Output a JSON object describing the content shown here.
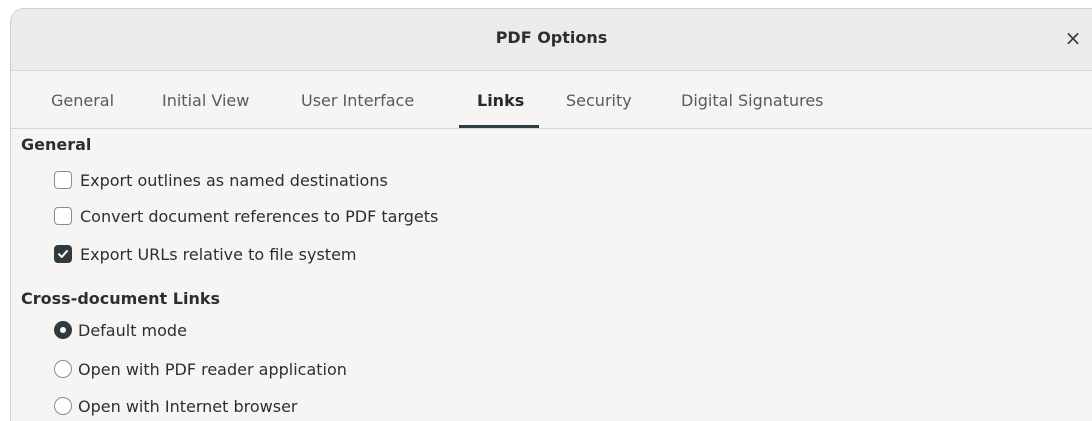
{
  "window": {
    "title": "PDF Options",
    "close_label": "×"
  },
  "tabs": [
    {
      "label": "General",
      "active": false
    },
    {
      "label": "Initial View",
      "active": false
    },
    {
      "label": "User Interface",
      "active": false
    },
    {
      "label": "Links",
      "active": true
    },
    {
      "label": "Security",
      "active": false
    },
    {
      "label": "Digital Signatures",
      "active": false
    }
  ],
  "general_section": {
    "heading": "General",
    "options": [
      {
        "label": "Export outlines as named destinations",
        "checked": false
      },
      {
        "label": "Convert document references to PDF targets",
        "checked": false
      },
      {
        "label": "Export URLs relative to file system",
        "checked": true
      }
    ]
  },
  "cross_document_section": {
    "heading": "Cross-document Links",
    "options": [
      {
        "label": "Default mode",
        "selected": true
      },
      {
        "label": "Open with PDF reader application",
        "selected": false
      },
      {
        "label": "Open with Internet browser",
        "selected": false
      }
    ]
  },
  "colors": {
    "accent": "#303a3f",
    "window_bg": "#f6f5f4",
    "titlebar_bg": "#ebebeb"
  }
}
